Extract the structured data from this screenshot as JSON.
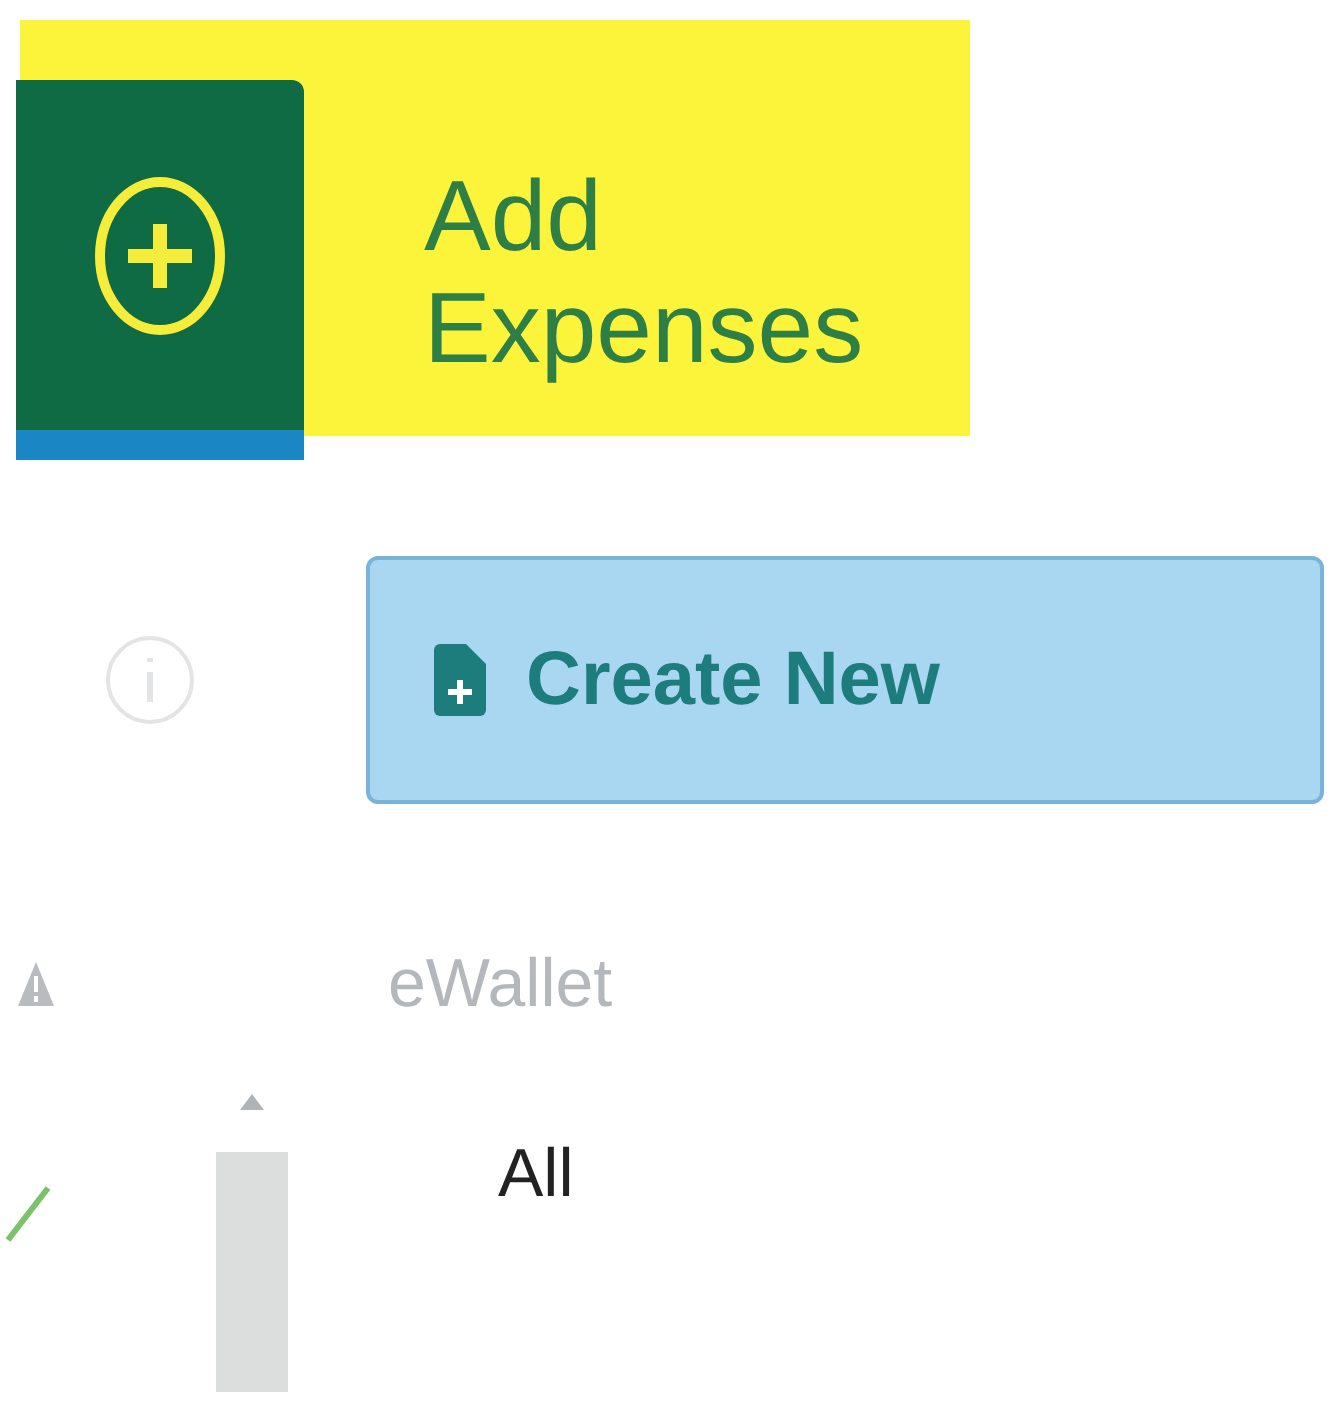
{
  "banner": {
    "title_lines": [
      "Add",
      "Expenses"
    ]
  },
  "create_button": {
    "label": "Create New"
  },
  "section": {
    "heading": "eWallet"
  },
  "items": [
    {
      "label": "All"
    }
  ]
}
